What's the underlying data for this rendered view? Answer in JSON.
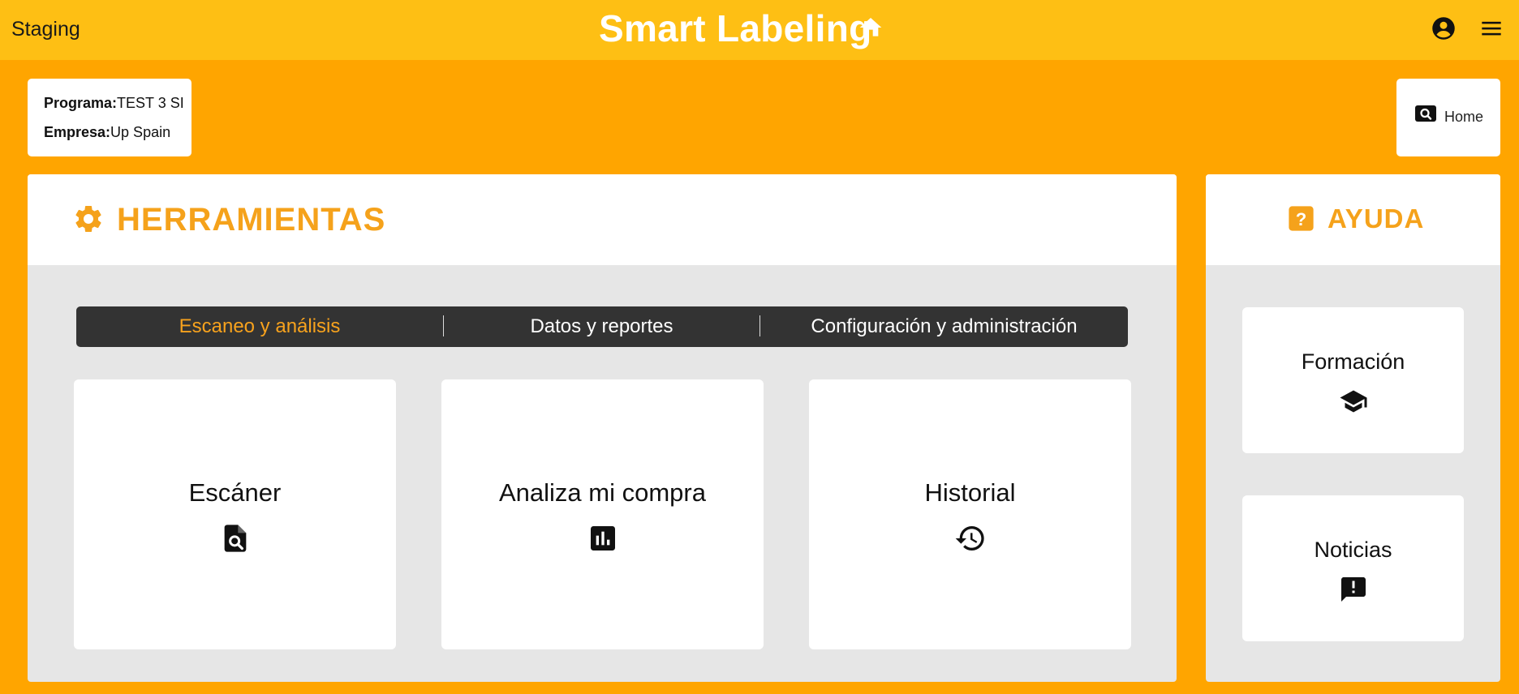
{
  "header": {
    "environment": "Staging",
    "title": "Smart Labeling",
    "icons": {
      "home": "home-icon",
      "account": "account-circle-icon",
      "menu": "hamburger-menu-icon"
    }
  },
  "info": {
    "program_label": "Programa:",
    "program_value": "TEST 3 SI",
    "company_label": "Empresa:",
    "company_value": "Up Spain"
  },
  "home_button": {
    "label": "Home",
    "icon": "search-icon"
  },
  "tools": {
    "title": "HERRAMIENTAS",
    "icon": "gear-icon",
    "tabs": [
      {
        "label": "Escaneo y análisis",
        "active": true
      },
      {
        "label": "Datos y reportes",
        "active": false
      },
      {
        "label": "Configuración y administración",
        "active": false
      }
    ],
    "cards": [
      {
        "label": "Escáner",
        "icon": "document-search-icon"
      },
      {
        "label": "Analiza mi compra",
        "icon": "bar-chart-icon"
      },
      {
        "label": "Historial",
        "icon": "history-icon"
      }
    ]
  },
  "help": {
    "title": "AYUDA",
    "icon": "help-question-icon",
    "cards": [
      {
        "label": "Formación",
        "icon": "graduation-cap-icon"
      },
      {
        "label": "Noticias",
        "icon": "announcement-icon"
      }
    ]
  },
  "colors": {
    "background": "#FFA500",
    "header": "#FEBF14",
    "accent": "#F5A21B",
    "tabbar": "#333333",
    "panel": "#E6E6E6"
  }
}
